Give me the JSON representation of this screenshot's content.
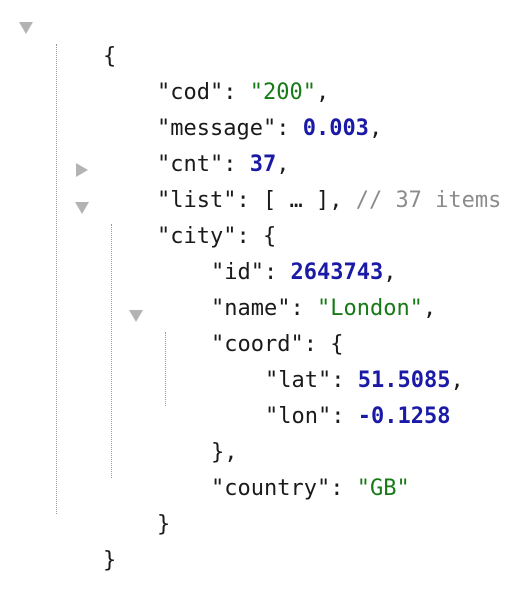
{
  "json_viewer": {
    "root_open": "{",
    "root_close": "}",
    "cod": {
      "key": "\"cod\"",
      "value": "\"200\""
    },
    "message": {
      "key": "\"message\"",
      "value": "0.003"
    },
    "cnt": {
      "key": "\"cnt\"",
      "value": "37"
    },
    "list": {
      "key": "\"list\"",
      "collapsed": "[ … ]",
      "comment": "// 37 items"
    },
    "city": {
      "key": "\"city\"",
      "open": "{",
      "close": "}",
      "id": {
        "key": "\"id\"",
        "value": "2643743"
      },
      "name": {
        "key": "\"name\"",
        "value": "\"London\""
      },
      "coord": {
        "key": "\"coord\"",
        "open": "{",
        "close": "},",
        "lat": {
          "key": "\"lat\"",
          "value": "51.5085"
        },
        "lon": {
          "key": "\"lon\"",
          "value": "-0.1258"
        }
      },
      "country": {
        "key": "\"country\"",
        "value": "\"GB\""
      }
    }
  }
}
